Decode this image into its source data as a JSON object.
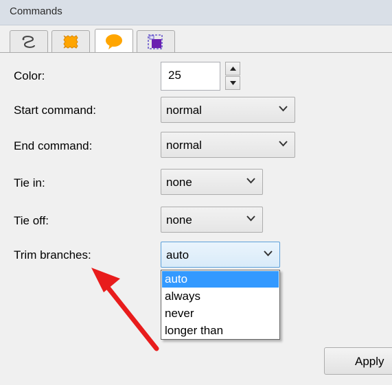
{
  "window": {
    "title": "Commands"
  },
  "tabs": [
    {
      "icon": "route-icon"
    },
    {
      "icon": "stamp-icon"
    },
    {
      "icon": "speech-bubble-icon",
      "active": true
    },
    {
      "icon": "select-region-icon"
    }
  ],
  "form": {
    "color": {
      "label": "Color:",
      "value": "25"
    },
    "start_command": {
      "label": "Start command:",
      "value": "normal"
    },
    "end_command": {
      "label": "End command:",
      "value": "normal"
    },
    "tie_in": {
      "label": "Tie in:",
      "value": "none"
    },
    "tie_off": {
      "label": "Tie off:",
      "value": "none"
    },
    "trim_branches": {
      "label": "Trim branches:",
      "value": "auto",
      "options": [
        "auto",
        "always",
        "never",
        "longer than"
      ],
      "selected": "auto"
    }
  },
  "buttons": {
    "apply_label": "Apply"
  },
  "colors": {
    "accent": "#3399ff",
    "annotation": "#e81c1c",
    "tab_icon": "#ffa500"
  }
}
